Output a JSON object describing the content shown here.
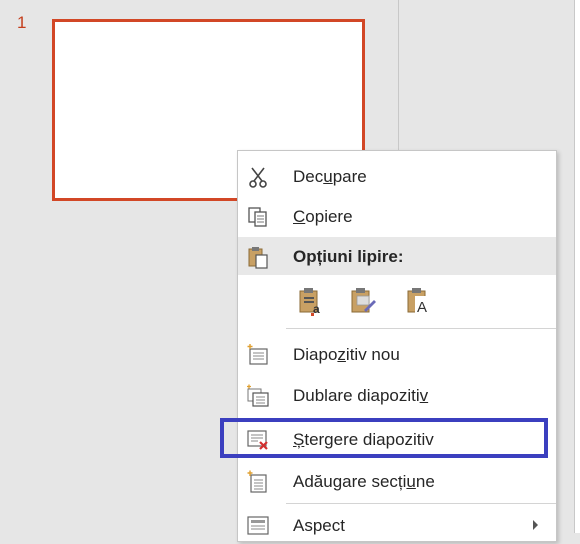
{
  "slide_panel": {
    "slide_number": "1"
  },
  "context_menu": {
    "cut": {
      "label_pre": "Dec",
      "label_key": "u",
      "label_post": "pare",
      "icon": "scissors-icon"
    },
    "copy": {
      "label_pre": "",
      "label_key": "C",
      "label_post": "opiere",
      "icon": "copy-icon"
    },
    "paste_options": {
      "label": "Opțiuni lipire:",
      "icon": "clipboard-icon",
      "options": [
        "paste-use-destination-theme-icon",
        "paste-picture-icon",
        "paste-keep-text-only-icon"
      ]
    },
    "new_slide": {
      "label_pre": "Diapo",
      "label_key": "z",
      "label_post": "itiv nou",
      "icon": "new-slide-icon"
    },
    "duplicate_slide": {
      "label_pre": "Dublare diapoziti",
      "label_key": "v",
      "label_post": "",
      "icon": "duplicate-slide-icon"
    },
    "delete_slide": {
      "label_pre": "",
      "label_key": "Ș",
      "label_post": "tergere diapozitiv",
      "icon": "delete-slide-icon"
    },
    "add_section": {
      "label_pre": "Adăugare secți",
      "label_key": "u",
      "label_post": "ne",
      "icon": "add-section-icon"
    },
    "layout": {
      "label_pre": "Aspect",
      "label_key": "",
      "label_post": "",
      "icon": "layout-icon"
    }
  },
  "colors": {
    "slide_border": "#d24726",
    "highlight_box": "#3b3fbf",
    "menu_header_bg": "#e8e8e8"
  }
}
